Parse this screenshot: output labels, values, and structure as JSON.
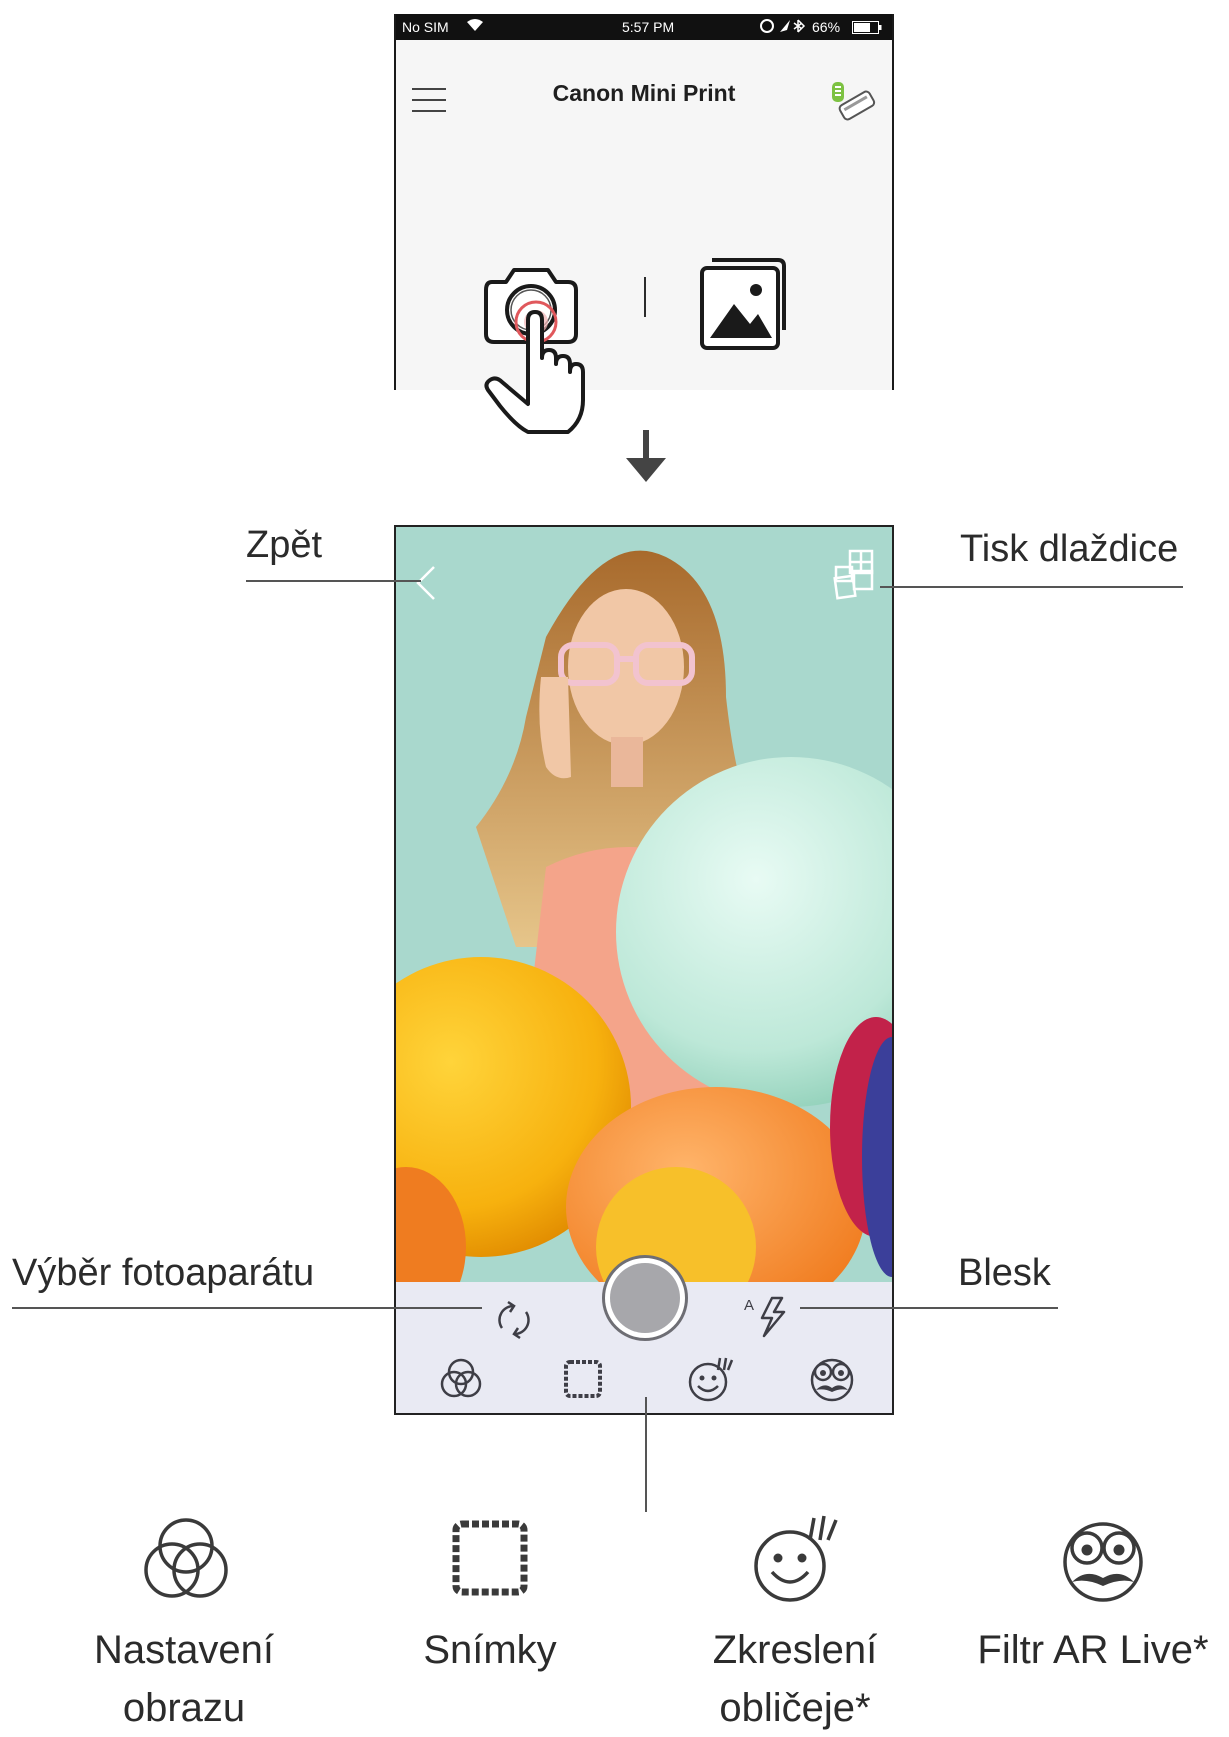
{
  "status_bar": {
    "carrier": "No SIM",
    "time": "5:57 PM",
    "battery": "66%"
  },
  "app_header": {
    "title": "Canon Mini Print"
  },
  "callouts": {
    "back": "Zpět",
    "tile_print": "Tisk dlaždice",
    "camera_select": "Výběr fotoaparátu",
    "flash": "Blesk"
  },
  "legend": {
    "image_adjust_line1": "Nastavení",
    "image_adjust_line2": "obrazu",
    "frames": "Snímky",
    "face_distort_line1": "Zkreslení",
    "face_distort_line2": "obličeje*",
    "ar_filter": "Filtr AR Live*"
  },
  "icons": {
    "menu": "hamburger-icon",
    "printer": "printer-status-icon",
    "camera": "camera-icon",
    "gallery": "gallery-icon",
    "back": "chevron-left-icon",
    "tile": "tile-print-icon",
    "switch_camera": "switch-camera-icon",
    "flash": "flash-auto-icon",
    "adjust": "color-circles-icon",
    "frames": "frame-icon",
    "face": "face-distort-icon",
    "ar": "ar-mustache-icon"
  },
  "colors": {
    "photo_bg": "#a9d8cd",
    "bar_bg": "#e9eaf3",
    "accent_touch": "#e0585c",
    "battery_green": "#7dc242"
  }
}
